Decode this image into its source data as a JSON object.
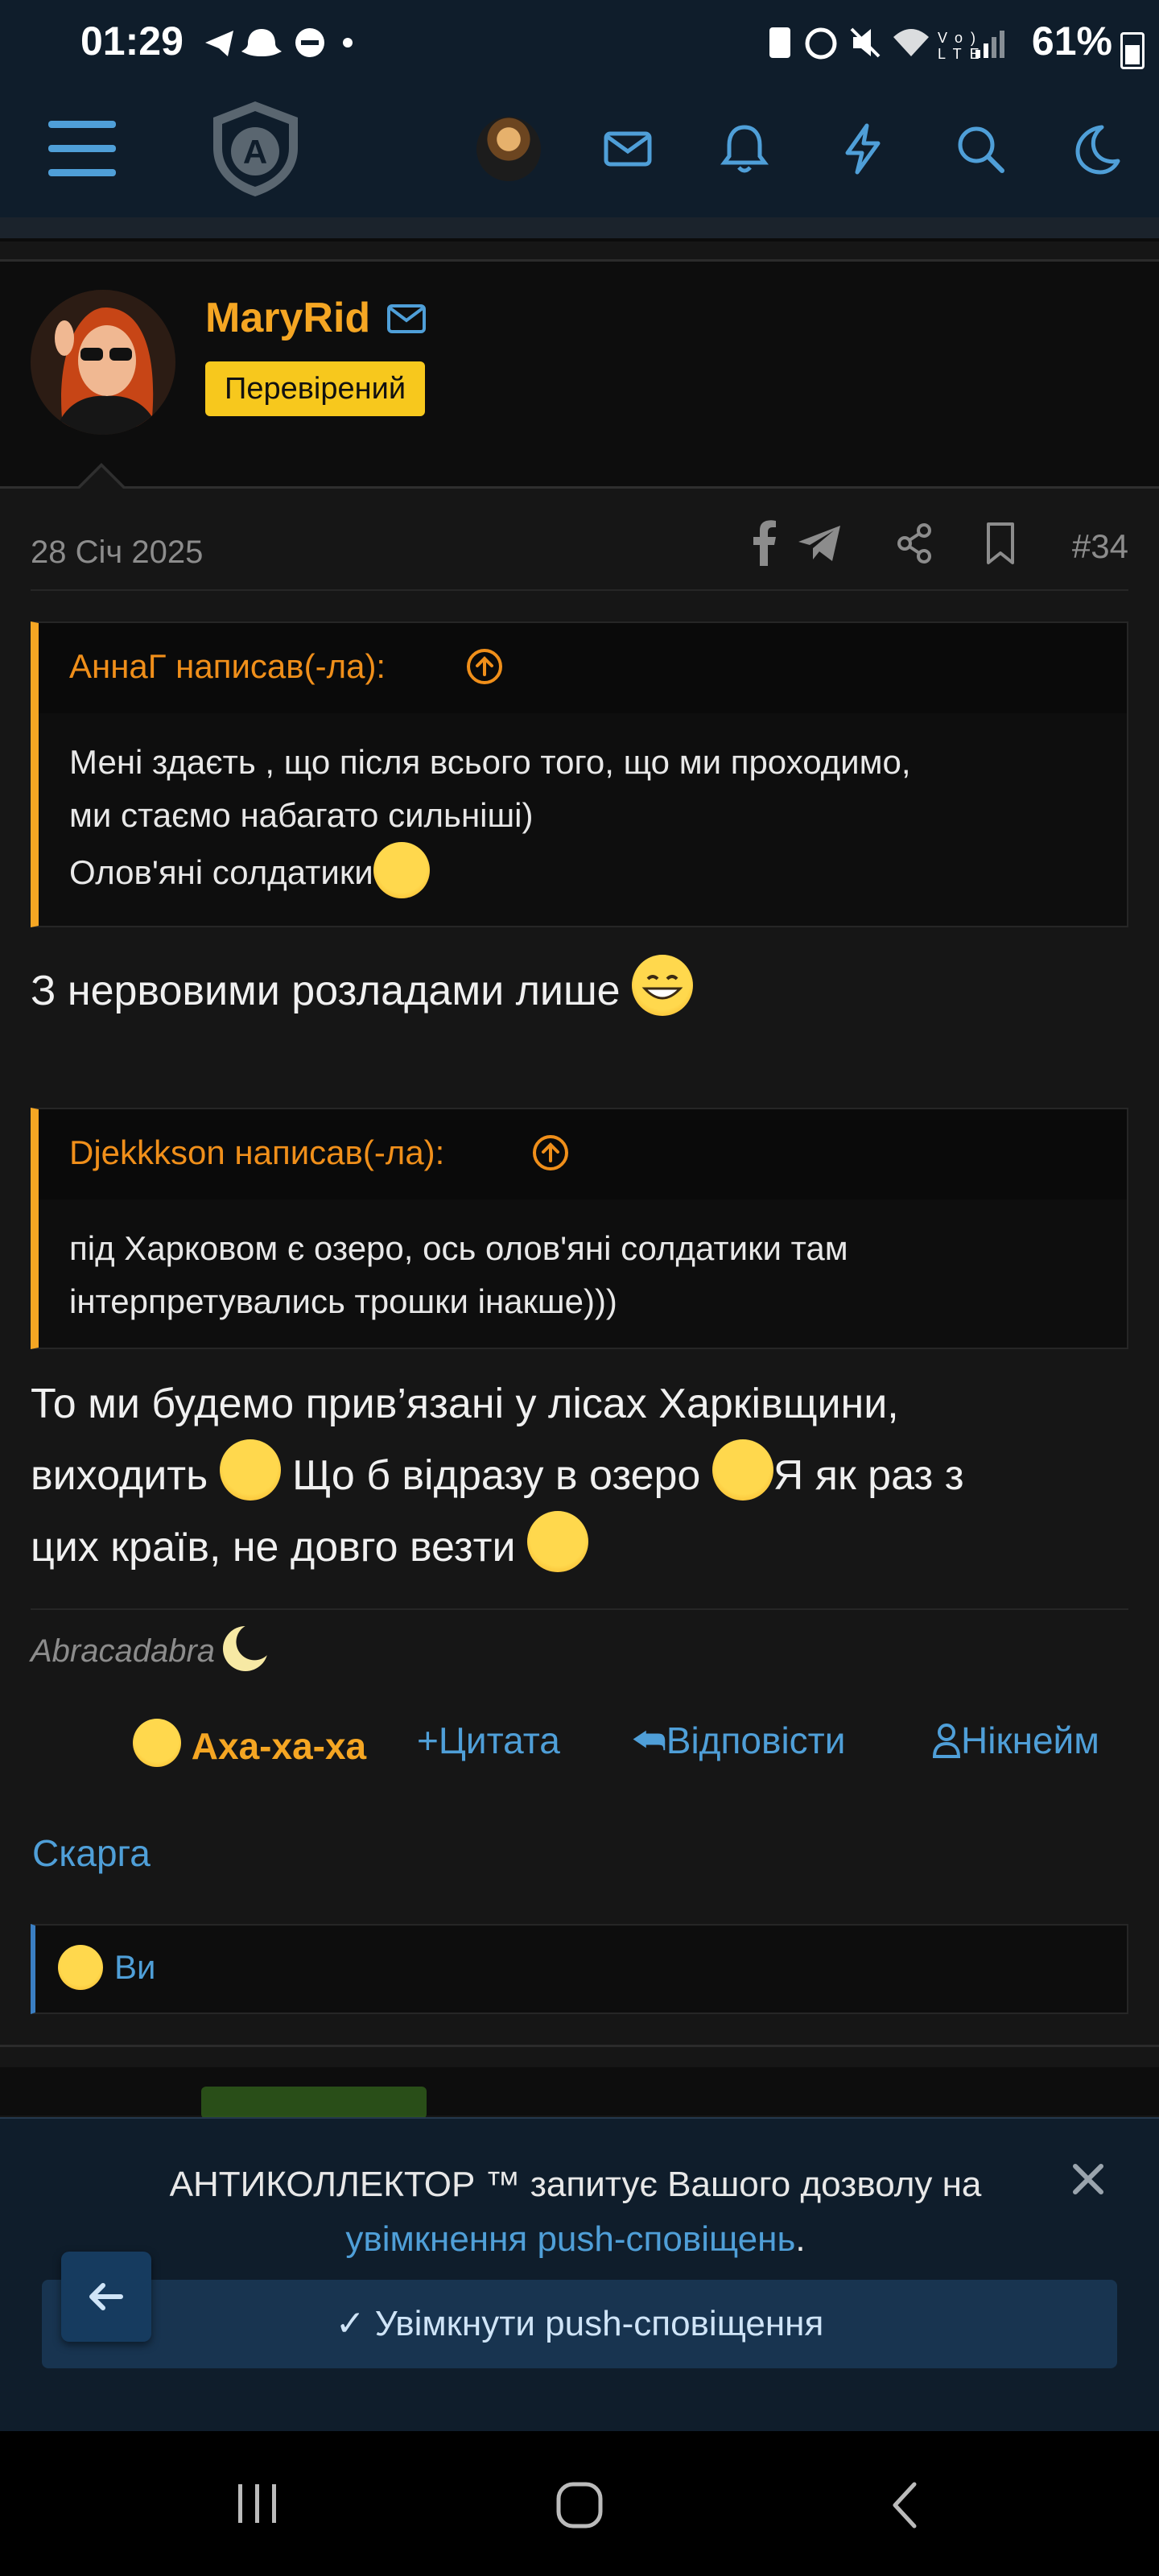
{
  "status_bar": {
    "time": "01:29",
    "battery": "61%",
    "left_icons": "telegram-icon snapchat-icon dnd-icon dot",
    "right_icons": "sim-icon alarm-icon mute-icon wifi-icon volte-icon signal-icon"
  },
  "nav": {
    "logo_letter": "A",
    "icons": [
      "menu-icon",
      "logo",
      "avatar",
      "mail-icon",
      "bell-icon",
      "bolt-icon",
      "search-icon",
      "moon-icon"
    ]
  },
  "post": {
    "username": "MaryRid",
    "badge": "Перевірений",
    "date": "28 Січ 2025",
    "number": "#34",
    "quotes": [
      {
        "author": "АннаГ написав(-ла):",
        "lines": [
          "Мені здаєть , що після всього того, що ми проходимо,",
          "ми стаємо набагато сильніші)",
          "Олов'яні солдатики"
        ]
      },
      {
        "author": "Djekkkson написав(-ла):",
        "lines": [
          "під Харковом є озеро, ось олов'яні солдатики там",
          "інтерпретувались трошки інакше)))"
        ]
      }
    ],
    "message_1": "З нервовими розладами лише",
    "message_2": {
      "line1": "То ми будемо прив’язані у лісах Харківщини,",
      "line2a": "виходить",
      "line2b": "Що б відразу в озеро",
      "line2c": "Я як раз з",
      "line3": "цих країв, не довго везти"
    },
    "signature": "Abracadabra",
    "actions": {
      "reaction": "Аха-ха-ха",
      "quote": "Цитата",
      "reply": "Відповісти",
      "nickname": "Нікнейм",
      "report": "Скарга"
    },
    "reactions_summary": "Ви"
  },
  "push_prompt": {
    "text_line1": "АНТИКОЛЛЕКТОР ™ запитує Вашого дозволу на",
    "link": "увімкнення push-сповіщень",
    "text_tail": ".",
    "button": "Увімкнути push-сповіщення"
  },
  "colors": {
    "accent_blue": "#4f9fd8",
    "username_orange": "#f5a623",
    "badge_yellow": "#f7c81d",
    "nav_bg": "#0f1d2b"
  }
}
